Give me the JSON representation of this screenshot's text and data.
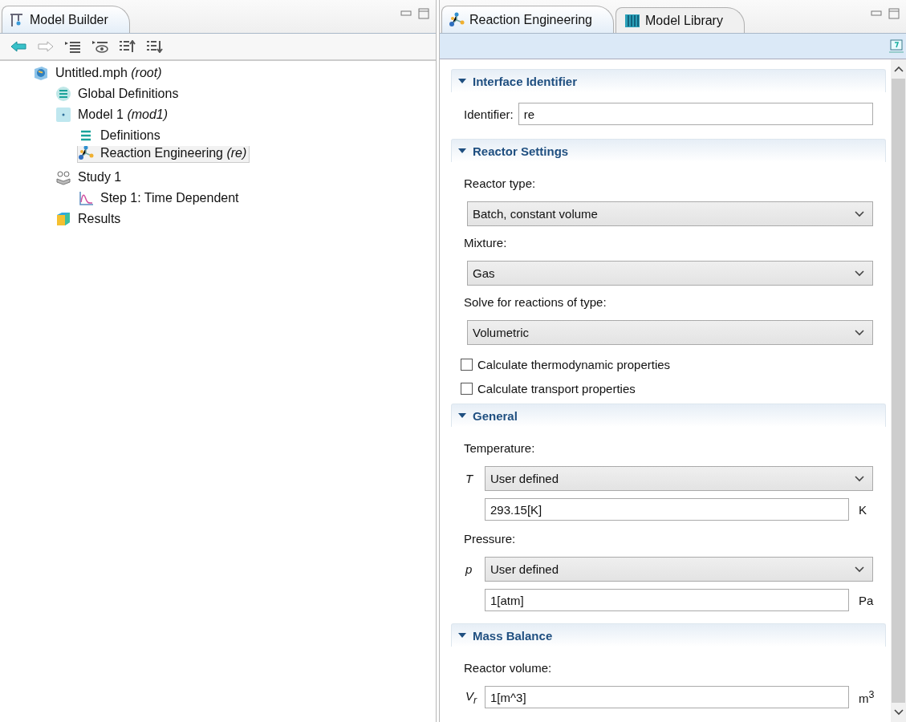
{
  "model_builder": {
    "tabs": [
      {
        "label": "Model Builder",
        "kind": "builder",
        "selected": true
      }
    ],
    "tree": [
      {
        "label": "Untitled.mph *(root)*",
        "kind": "root",
        "selected": false,
        "children": [
          {
            "label": "Global Definitions",
            "kind": "global",
            "selected": false
          },
          {
            "label": "Model 1 *(mod1)*",
            "kind": "model",
            "selected": false,
            "children": [
              {
                "label": "Definitions",
                "kind": "definitions",
                "selected": false
              },
              {
                "label": "Reaction Engineering *(re)*",
                "kind": "physics",
                "selected": true
              }
            ]
          },
          {
            "label": "Study 1",
            "kind": "study",
            "selected": false,
            "children": [
              {
                "label": "Step 1: Time Dependent",
                "kind": "step",
                "selected": false
              }
            ]
          },
          {
            "label": "Results",
            "kind": "results",
            "selected": false
          }
        ]
      }
    ]
  },
  "settings": {
    "tabs": [
      {
        "label": "Reaction Engineering",
        "kind": "physics",
        "selected": true
      },
      {
        "label": "Model Library",
        "kind": "library",
        "selected": false
      }
    ],
    "sections": [
      {
        "title": "Interface Identifier",
        "expanded": true,
        "fields": [
          {
            "kind": "inline-input",
            "label": "Identifier:",
            "value": "re"
          }
        ]
      },
      {
        "title": "Reactor Settings",
        "expanded": true,
        "fields": [
          {
            "kind": "label",
            "text": "Reactor type:"
          },
          {
            "kind": "select",
            "value": "Batch, constant volume"
          },
          {
            "kind": "label",
            "text": "Mixture:"
          },
          {
            "kind": "select",
            "value": "Gas"
          },
          {
            "kind": "label",
            "text": "Solve for reactions of type:"
          },
          {
            "kind": "select",
            "value": "Volumetric"
          },
          {
            "kind": "checkbox",
            "label": "Calculate thermodynamic properties",
            "checked": false
          },
          {
            "kind": "checkbox",
            "label": "Calculate transport properties",
            "checked": false
          }
        ]
      },
      {
        "title": "General",
        "expanded": true,
        "fields": [
          {
            "kind": "label",
            "text": "Temperature:"
          },
          {
            "kind": "select",
            "symbol": "T",
            "value": "User defined"
          },
          {
            "kind": "input",
            "value": "293.15[K]",
            "unit": "K"
          },
          {
            "kind": "label",
            "text": "Pressure:"
          },
          {
            "kind": "select",
            "symbol": "p",
            "value": "User defined"
          },
          {
            "kind": "input",
            "value": "1[atm]",
            "unit": "Pa"
          }
        ]
      },
      {
        "title": "Mass Balance",
        "expanded": true,
        "fields": [
          {
            "kind": "label",
            "text": "Reactor volume:"
          },
          {
            "kind": "input",
            "symbol": "V$_{r}$",
            "value": "1[m^3]",
            "unit": "m$^{3}$"
          }
        ]
      }
    ]
  }
}
